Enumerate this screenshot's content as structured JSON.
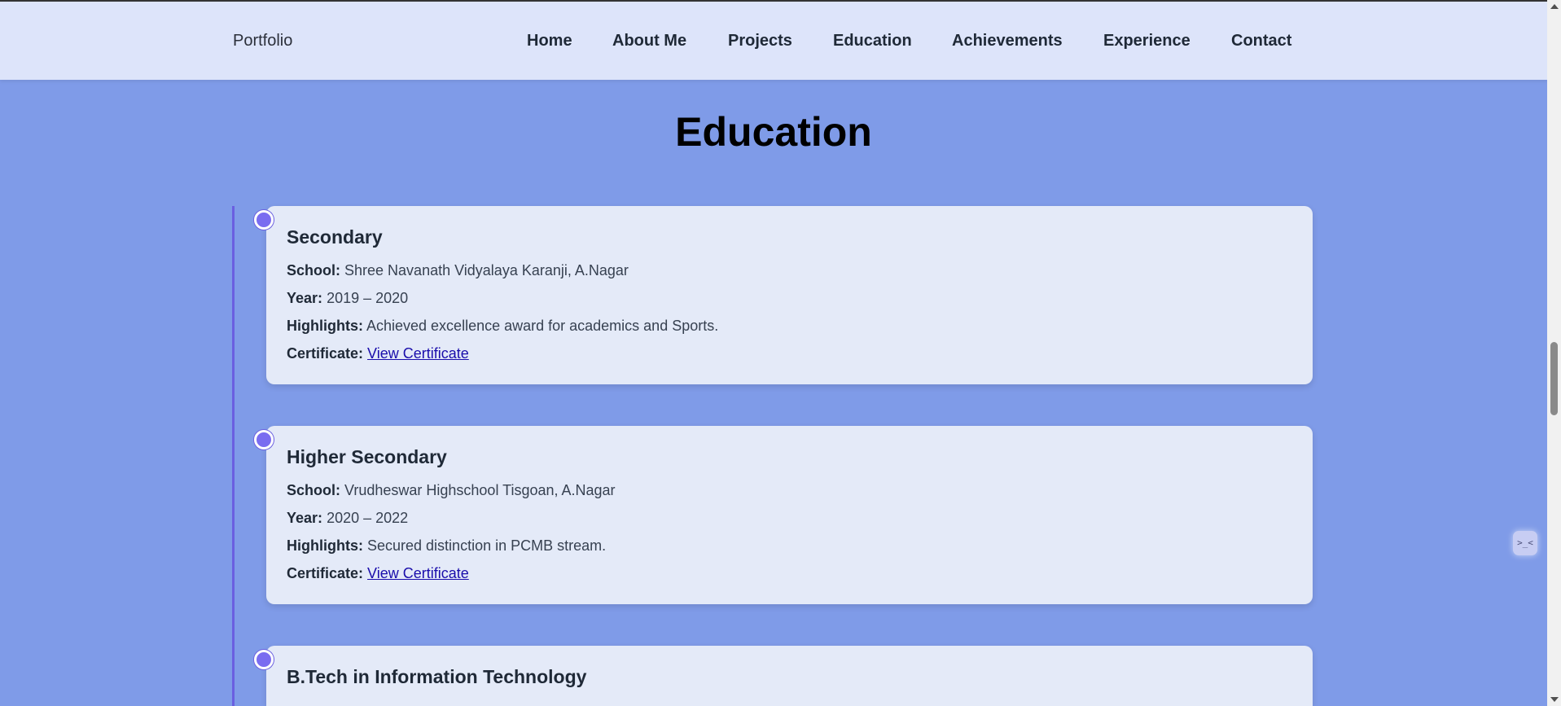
{
  "navbar": {
    "brand": "Portfolio",
    "links": [
      "Home",
      "About Me",
      "Projects",
      "Education",
      "Achievements",
      "Experience",
      "Contact"
    ]
  },
  "section": {
    "title": "Education"
  },
  "education": [
    {
      "title": "Secondary",
      "fields": [
        {
          "label": "School:",
          "value": "Shree Navanath Vidyalaya Karanji, A.Nagar"
        },
        {
          "label": "Year:",
          "value": "2019 – 2020"
        },
        {
          "label": "Highlights:",
          "value": "Achieved excellence award for academics and Sports."
        }
      ],
      "certificate_label": "Certificate:",
      "certificate_link": "View Certificate"
    },
    {
      "title": "Higher Secondary",
      "fields": [
        {
          "label": "School:",
          "value": "Vrudheswar Highschool Tisgoan, A.Nagar"
        },
        {
          "label": "Year:",
          "value": "2020 – 2022"
        },
        {
          "label": "Highlights:",
          "value": "Secured distinction in PCMB stream."
        }
      ],
      "certificate_label": "Certificate:",
      "certificate_link": "View Certificate"
    },
    {
      "title": "B.Tech in Information Technology"
    }
  ],
  "widget": {
    "glyph": ">_<"
  },
  "colors": {
    "page_background": "#7f9be8",
    "navbar_background": "#dde4fa",
    "card_background": "#e4eaf8",
    "timeline_accent": "#6a5fe0",
    "link": "#1a0dab"
  }
}
